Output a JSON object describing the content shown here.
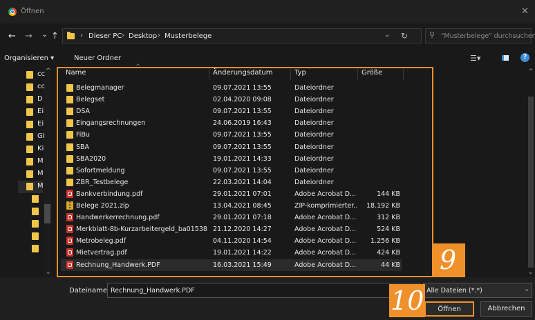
{
  "window": {
    "title": "Öffnen",
    "close": "✕"
  },
  "nav": {
    "back": "←",
    "forward": "→",
    "recent": "⌄",
    "up": "↑",
    "breadcrumb": [
      "Dieser PC",
      "Desktop",
      "Musterbelege"
    ],
    "search_placeholder": "\"Musterbelege\" durchsuchen"
  },
  "toolbar": {
    "organize": "Organisieren ▾",
    "new_folder": "Neuer Ordner"
  },
  "sidebar": {
    "items": [
      "cc",
      "cc",
      "D",
      "Ei",
      "Ei",
      "GI",
      "Ki",
      "M",
      "M",
      "M",
      "",
      "",
      "",
      "",
      ""
    ]
  },
  "columns": {
    "name": "Name",
    "date": "Änderungsdatum",
    "type": "Typ",
    "size": "Größe"
  },
  "files": [
    {
      "name": "Belegmanager",
      "date": "09.07.2021 13:55",
      "type": "Dateiordner",
      "size": "",
      "icon": "folder"
    },
    {
      "name": "Belegset",
      "date": "02.04.2020 09:08",
      "type": "Dateiordner",
      "size": "",
      "icon": "folder"
    },
    {
      "name": "DSA",
      "date": "09.07.2021 13:55",
      "type": "Dateiordner",
      "size": "",
      "icon": "folder"
    },
    {
      "name": "Eingangsrechnungen",
      "date": "24.06.2019 16:43",
      "type": "Dateiordner",
      "size": "",
      "icon": "folder"
    },
    {
      "name": "FiBu",
      "date": "09.07.2021 13:55",
      "type": "Dateiordner",
      "size": "",
      "icon": "folder"
    },
    {
      "name": "SBA",
      "date": "09.07.2021 13:55",
      "type": "Dateiordner",
      "size": "",
      "icon": "folder"
    },
    {
      "name": "SBA2020",
      "date": "19.01.2021 14:33",
      "type": "Dateiordner",
      "size": "",
      "icon": "folder"
    },
    {
      "name": "Sofortmeldung",
      "date": "09.07.2021 13:55",
      "type": "Dateiordner",
      "size": "",
      "icon": "folder"
    },
    {
      "name": "ZBR_Testbelege",
      "date": "22.03.2021 14:04",
      "type": "Dateiordner",
      "size": "",
      "icon": "folder"
    },
    {
      "name": "Bankverbindung.pdf",
      "date": "29.01.2021 07:01",
      "type": "Adobe Acrobat D...",
      "size": "144 KB",
      "icon": "pdf"
    },
    {
      "name": "Belege 2021.zip",
      "date": "13.04.2021 08:45",
      "type": "ZIP-komprimierter...",
      "size": "18.192 KB",
      "icon": "zip"
    },
    {
      "name": "Handwerkerrechnung.pdf",
      "date": "29.01.2021 07:18",
      "type": "Adobe Acrobat D...",
      "size": "312 KB",
      "icon": "pdf"
    },
    {
      "name": "Merkblatt-8b-Kurzarbeitergeld_ba01538...",
      "date": "21.12.2020 14:27",
      "type": "Adobe Acrobat D...",
      "size": "524 KB",
      "icon": "pdf"
    },
    {
      "name": "Metrobeleg.pdf",
      "date": "04.11.2020 14:54",
      "type": "Adobe Acrobat D...",
      "size": "1.256 KB",
      "icon": "pdf"
    },
    {
      "name": "Mietvertrag.pdf",
      "date": "19.01.2021 14:22",
      "type": "Adobe Acrobat D...",
      "size": "424 KB",
      "icon": "pdf"
    },
    {
      "name": "Rechnung_Handwerk.PDF",
      "date": "16.03.2021 15:49",
      "type": "Adobe Acrobat D...",
      "size": "44 KB",
      "icon": "pdf",
      "selected": true
    }
  ],
  "annotations": {
    "step9": "9",
    "step10": "10",
    "highlight_color": "#f0902a"
  },
  "bottom": {
    "filename_label": "Dateiname:",
    "filename_value": "Rechnung_Handwerk.PDF",
    "filetype_value": "Alle Dateien (*.*)",
    "open": "Öffnen",
    "cancel": "Abbrechen"
  }
}
